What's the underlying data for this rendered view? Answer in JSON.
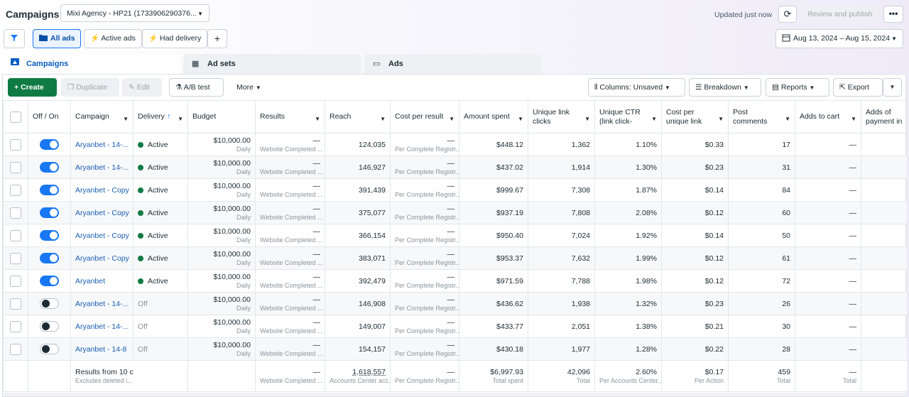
{
  "header": {
    "title": "Campaigns",
    "account": "Mixi Agency - HP21 (1733906290376...",
    "updated": "Updated just now",
    "review_publish": "Review and publish",
    "more_dots": "•••"
  },
  "filters": {
    "all_ads": "All ads",
    "active_ads": "Active ads",
    "had_delivery": "Had delivery",
    "add": "+",
    "date_range": "Aug 13, 2024 – Aug 15, 2024"
  },
  "tabs": {
    "campaigns": "Campaigns",
    "ad_sets": "Ad sets",
    "ads": "Ads"
  },
  "toolbar": {
    "create": "Create",
    "duplicate": "Duplicate",
    "edit": "Edit",
    "ab_test": "A/B test",
    "more": "More",
    "columns": "Columns: Unsaved",
    "breakdown": "Breakdown",
    "reports": "Reports",
    "export": "Export"
  },
  "columns": {
    "off_on": "Off / On",
    "campaign": "Campaign",
    "delivery": "Delivery",
    "budget": "Budget",
    "results": "Results",
    "reach": "Reach",
    "cost_per_result": "Cost per result",
    "amount_spent": "Amount spent",
    "unique_link_clicks": "Unique link clicks",
    "unique_ctr": "Unique CTR (link click-through rate)",
    "cost_per_unique": "Cost per unique link click",
    "post_comments": "Post comments",
    "adds_to_cart": "Adds to cart",
    "adds_payment": "Adds of payment in"
  },
  "rows": [
    {
      "on": true,
      "name": "Aryanbet - 14-...",
      "delivery": "Active",
      "budget": "$10,000.00",
      "budget_sub": "Daily",
      "results": "—",
      "results_sub": "Website Completed ...",
      "reach": "124,035",
      "cpr": "—",
      "cpr_sub": "Per Complete Registr...",
      "spent": "$448.12",
      "ulc": "1,362",
      "uctr": "1.10%",
      "cpulc": "$0.33",
      "comments": "17",
      "atc": "—"
    },
    {
      "on": true,
      "name": "Aryanbet - 14-...",
      "delivery": "Active",
      "budget": "$10,000.00",
      "budget_sub": "Daily",
      "results": "—",
      "results_sub": "Website Completed ...",
      "reach": "146,927",
      "cpr": "—",
      "cpr_sub": "Per Complete Registr...",
      "spent": "$437.02",
      "ulc": "1,914",
      "uctr": "1.30%",
      "cpulc": "$0.23",
      "comments": "31",
      "atc": "—"
    },
    {
      "on": true,
      "name": "Aryanbet - Copy",
      "delivery": "Active",
      "budget": "$10,000.00",
      "budget_sub": "Daily",
      "results": "—",
      "results_sub": "Website Completed ...",
      "reach": "391,439",
      "cpr": "—",
      "cpr_sub": "Per Complete Registr...",
      "spent": "$999.67",
      "ulc": "7,308",
      "uctr": "1.87%",
      "cpulc": "$0.14",
      "comments": "84",
      "atc": "—"
    },
    {
      "on": true,
      "name": "Aryanbet - Copy",
      "delivery": "Active",
      "budget": "$10,000.00",
      "budget_sub": "Daily",
      "results": "—",
      "results_sub": "Website Completed ...",
      "reach": "375,077",
      "cpr": "—",
      "cpr_sub": "Per Complete Registr...",
      "spent": "$937.19",
      "ulc": "7,808",
      "uctr": "2.08%",
      "cpulc": "$0.12",
      "comments": "60",
      "atc": "—"
    },
    {
      "on": true,
      "name": "Aryanbet - Copy",
      "delivery": "Active",
      "budget": "$10,000.00",
      "budget_sub": "Daily",
      "results": "—",
      "results_sub": "Website Completed ...",
      "reach": "366,154",
      "cpr": "—",
      "cpr_sub": "Per Complete Registr...",
      "spent": "$950.40",
      "ulc": "7,024",
      "uctr": "1.92%",
      "cpulc": "$0.14",
      "comments": "50",
      "atc": "—"
    },
    {
      "on": true,
      "name": "Aryanbet - Copy",
      "delivery": "Active",
      "budget": "$10,000.00",
      "budget_sub": "Daily",
      "results": "—",
      "results_sub": "Website Completed ...",
      "reach": "383,071",
      "cpr": "—",
      "cpr_sub": "Per Complete Registr...",
      "spent": "$953.37",
      "ulc": "7,632",
      "uctr": "1.99%",
      "cpulc": "$0.12",
      "comments": "61",
      "atc": "—"
    },
    {
      "on": true,
      "name": "Aryanbet",
      "delivery": "Active",
      "budget": "$10,000.00",
      "budget_sub": "Daily",
      "results": "—",
      "results_sub": "Website Completed ...",
      "reach": "392,479",
      "cpr": "—",
      "cpr_sub": "Per Complete Registr...",
      "spent": "$971.59",
      "ulc": "7,788",
      "uctr": "1.98%",
      "cpulc": "$0.12",
      "comments": "72",
      "atc": "—"
    },
    {
      "on": false,
      "name": "Aryanbet - 14-...",
      "delivery": "Off",
      "budget": "$10,000.00",
      "budget_sub": "Daily",
      "results": "—",
      "results_sub": "Website Completed ...",
      "reach": "146,908",
      "cpr": "—",
      "cpr_sub": "Per Complete Registr...",
      "spent": "$436.62",
      "ulc": "1,938",
      "uctr": "1.32%",
      "cpulc": "$0.23",
      "comments": "26",
      "atc": "—"
    },
    {
      "on": false,
      "name": "Aryanbet - 14-...",
      "delivery": "Off",
      "budget": "$10,000.00",
      "budget_sub": "Daily",
      "results": "—",
      "results_sub": "Website Completed ...",
      "reach": "149,007",
      "cpr": "—",
      "cpr_sub": "Per Complete Registr...",
      "spent": "$433.77",
      "ulc": "2,051",
      "uctr": "1.38%",
      "cpulc": "$0.21",
      "comments": "30",
      "atc": "—"
    },
    {
      "on": false,
      "name": "Aryanbet - 14-8",
      "delivery": "Off",
      "budget": "$10,000.00",
      "budget_sub": "Daily",
      "results": "—",
      "results_sub": "Website Completed ...",
      "reach": "154,157",
      "cpr": "—",
      "cpr_sub": "Per Complete Registr...",
      "spent": "$430.18",
      "ulc": "1,977",
      "uctr": "1.28%",
      "cpulc": "$0.22",
      "comments": "28",
      "atc": "—"
    }
  ],
  "summary": {
    "label": "Results from 10 c",
    "label_sub": "Excludes deleted i...",
    "results": "—",
    "results_sub": "Website Completed ...",
    "reach": "1,618,557",
    "reach_sub": "Accounts Center acc...",
    "cpr": "—",
    "cpr_sub": "Per Complete Registr...",
    "spent": "$6,997.93",
    "spent_sub": "Total spent",
    "ulc": "42,096",
    "ulc_sub": "Total",
    "uctr": "2.60%",
    "uctr_sub": "Per Accounts Center...",
    "cpulc": "$0.17",
    "cpulc_sub": "Per Action",
    "comments": "459",
    "comments_sub": "Total",
    "atc": "—",
    "atc_sub": "Total"
  },
  "colors": {
    "primary_blue": "#1877f2",
    "create_green": "#0f7a43",
    "link_blue": "#1a5fb4"
  },
  "icons": [
    "filter-icon",
    "folder-icon",
    "lightning-icon",
    "calendar-icon",
    "refresh-icon",
    "grid-icon",
    "ad-icon",
    "pencil-icon",
    "flask-icon",
    "columns-icon",
    "breakdown-icon",
    "reports-icon",
    "export-icon"
  ]
}
